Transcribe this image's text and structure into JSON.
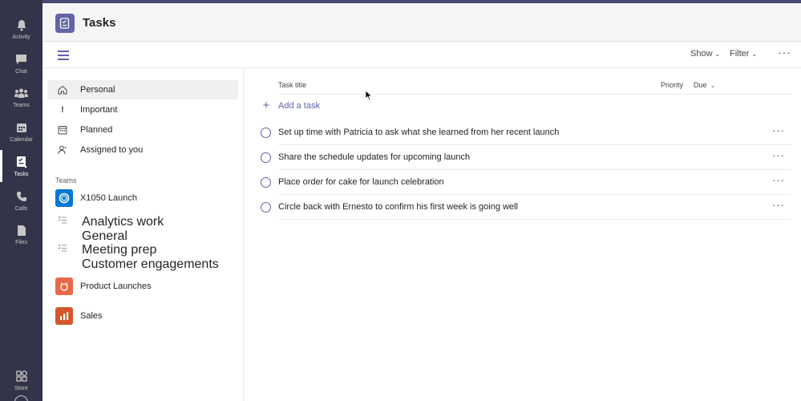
{
  "app_rail": [
    {
      "label": "Activity",
      "icon": "bell-icon"
    },
    {
      "label": "Chat",
      "icon": "chat-icon"
    },
    {
      "label": "Teams",
      "icon": "teams-icon"
    },
    {
      "label": "Calendar",
      "icon": "calendar-icon"
    },
    {
      "label": "Tasks",
      "icon": "tasks-icon",
      "active": true
    },
    {
      "label": "Calls",
      "icon": "phone-icon"
    },
    {
      "label": "Files",
      "icon": "file-icon"
    },
    {
      "label": "Store",
      "icon": "store-icon"
    }
  ],
  "header": {
    "title": "Tasks"
  },
  "toolbar": {
    "show_label": "Show",
    "filter_label": "Filter"
  },
  "sidebar": {
    "personal": [
      {
        "label": "Personal",
        "icon": "home-icon",
        "selected": true
      },
      {
        "label": "Important",
        "icon": "exclamation-icon"
      },
      {
        "label": "Planned",
        "icon": "calendar-grid-icon"
      },
      {
        "label": "Assigned to you",
        "icon": "person-icon"
      }
    ],
    "teams_label": "Teams",
    "teams": [
      {
        "label": "X1050 Launch",
        "icon": "team-logo-icon",
        "color": "#0078d4"
      },
      {
        "label": "Analytics work",
        "sub": "General",
        "icon": "plan-list-icon"
      },
      {
        "label": "Meeting prep",
        "sub": "Customer engagements",
        "icon": "plan-list-icon"
      },
      {
        "label": "Product Launches",
        "icon": "product-team-icon",
        "color": "#e8694a"
      },
      {
        "label": "Sales",
        "icon": "sales-team-icon",
        "color": "#d5562a"
      }
    ]
  },
  "main": {
    "col_title": "Task title",
    "col_priority": "Priority",
    "col_due": "Due",
    "add_task": "Add a task",
    "tasks": [
      {
        "title": "Set up time with Patricia to ask what she learned from her recent launch"
      },
      {
        "title": "Share the schedule updates for upcoming launch"
      },
      {
        "title": "Place order for cake for launch celebration"
      },
      {
        "title": "Circle back with Ernesto to confirm his first week is going well"
      }
    ]
  },
  "colors": {
    "accent": "#6264a7",
    "rail": "#33344a"
  }
}
